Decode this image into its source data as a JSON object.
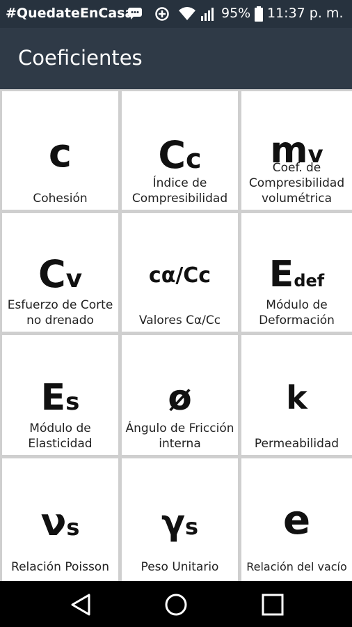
{
  "status_bar": {
    "hashtag": "#QuedateEnCasa",
    "battery": "95%",
    "time": "11:37 p. m."
  },
  "app_bar": {
    "title": "Coeficientes"
  },
  "tiles": [
    {
      "symbol": "c",
      "sub": "",
      "label": "Cohesión"
    },
    {
      "symbol": "C",
      "sub": "c",
      "label": "Índice de\nCompresibilidad"
    },
    {
      "symbol": "m",
      "sub": "v",
      "label": "Coef. de\nCompresibilidad\nvolumétrica"
    },
    {
      "symbol": "C",
      "sub": "v",
      "label": "Esfuerzo de Corte\nno drenado"
    },
    {
      "symbol": "cα/Cc",
      "sub": "",
      "label": "Valores Cα/Cc"
    },
    {
      "symbol": "E",
      "sub": "def",
      "label": "Módulo de\nDeformación"
    },
    {
      "symbol": "E",
      "sub": "s",
      "label": "Módulo de\nElasticidad"
    },
    {
      "symbol": "ø",
      "sub": "",
      "label": "Ángulo de Fricción\ninterna"
    },
    {
      "symbol": "k",
      "sub": "",
      "label": "Permeabilidad"
    },
    {
      "symbol": "ν",
      "sub": "s",
      "label": "Relación Poisson"
    },
    {
      "symbol": "γ",
      "sub": "s",
      "label": "Peso Unitario"
    },
    {
      "symbol": "e",
      "sub": "",
      "label": "Relación del vacío"
    }
  ]
}
